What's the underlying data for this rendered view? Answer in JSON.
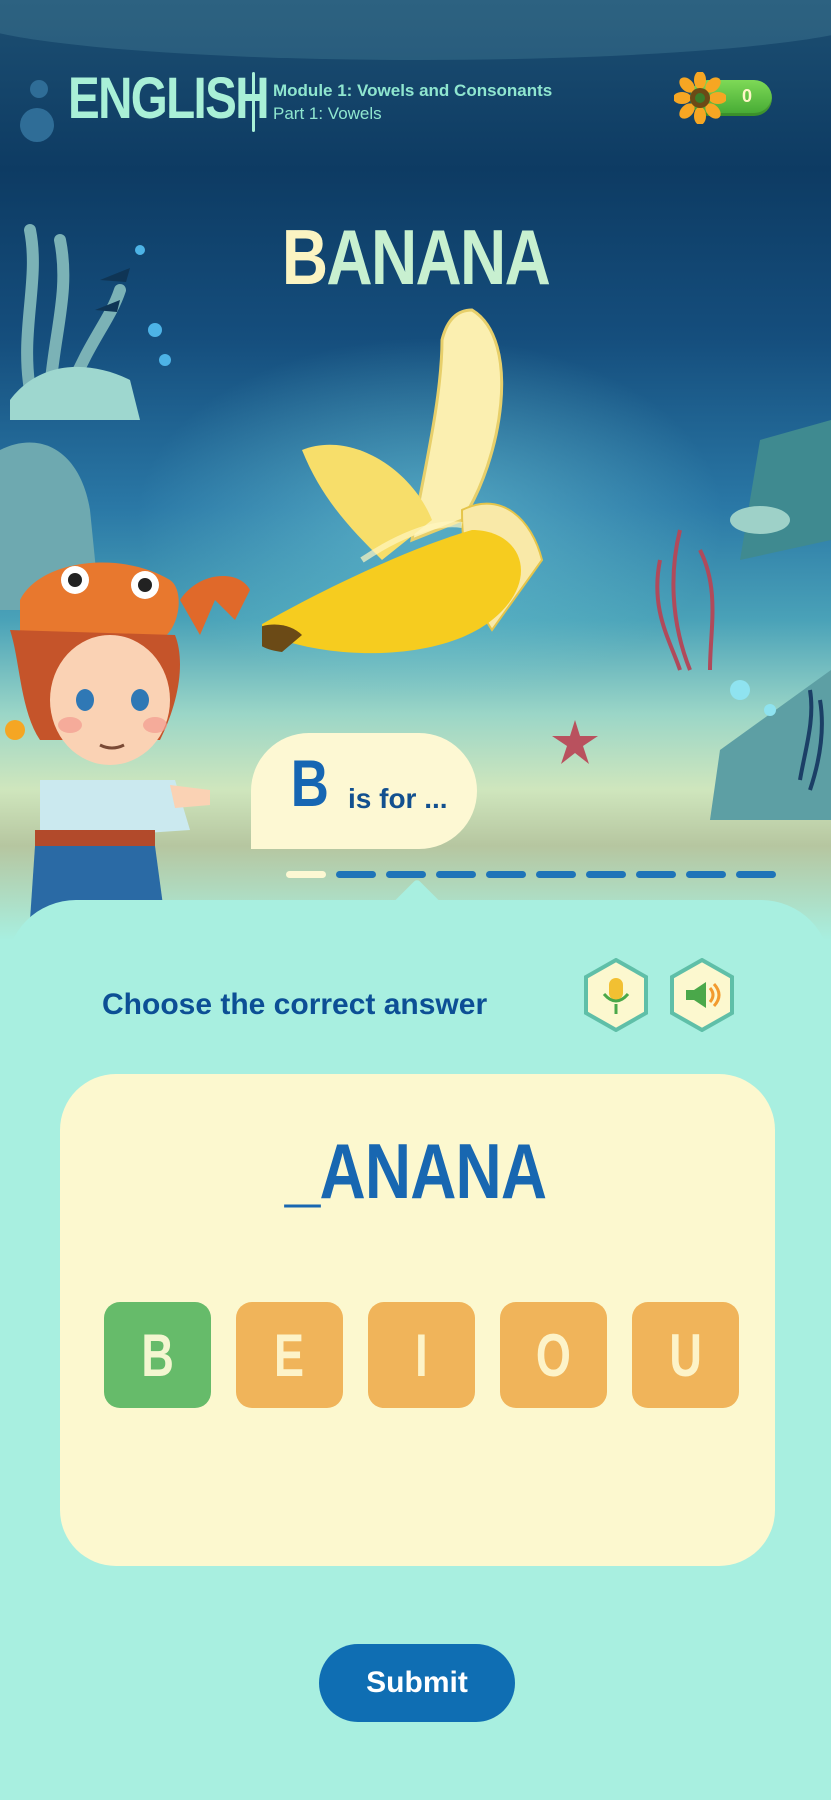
{
  "header": {
    "subject": "ENGLISH",
    "module": "Module 1: Vowels and Consonants",
    "part": "Part 1: Vowels",
    "score": "0"
  },
  "scene": {
    "word": "BANANA",
    "image_icon": "banana-icon",
    "character_icon": "crab-hat-girl-icon"
  },
  "speech": {
    "letter": "B",
    "text": "is for ..."
  },
  "progress": {
    "completed": 1,
    "total": 10
  },
  "quiz": {
    "prompt": "Choose the correct answer",
    "mic_icon": "microphone-icon",
    "speaker_icon": "speaker-icon",
    "blank_word": "_ANANA",
    "options": [
      {
        "label": "B",
        "selected": true
      },
      {
        "label": "E",
        "selected": false
      },
      {
        "label": "I",
        "selected": false
      },
      {
        "label": "O",
        "selected": false
      },
      {
        "label": "U",
        "selected": false
      }
    ],
    "submit_label": "Submit"
  },
  "colors": {
    "selected_option": "#66bb6a",
    "option": "#f0b45a",
    "primary": "#0f6eb3",
    "panel": "#a8efe0",
    "card": "#fcf8cf"
  }
}
